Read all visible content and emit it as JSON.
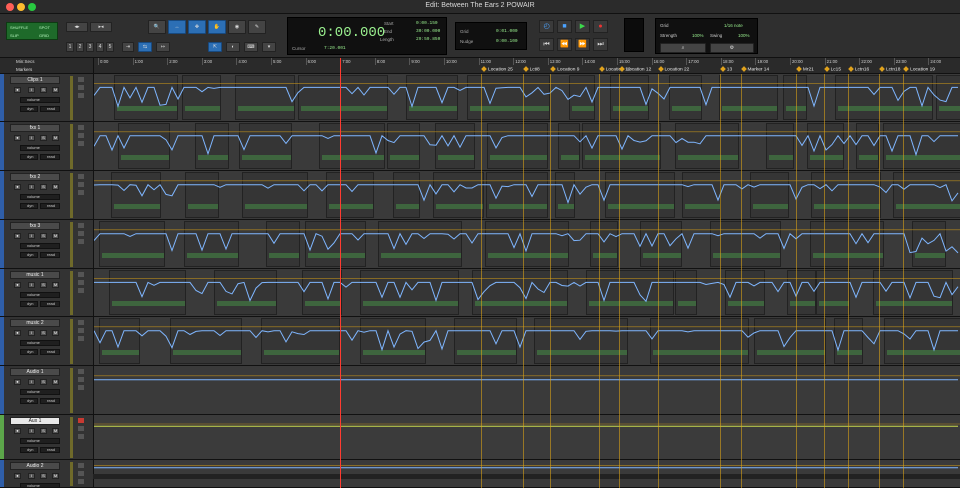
{
  "window": {
    "title": "Edit: Between The Ears 2 POWAIR"
  },
  "toolbar": {
    "modes": [
      "SHUFFLE",
      "SPOT",
      "SLIP",
      "GRID"
    ],
    "zoom_presets": [
      "1",
      "2",
      "3",
      "4",
      "5"
    ],
    "counter_main": "0:00.000",
    "cursor_label": "Cursor",
    "cursor_value": "7:20.001",
    "start_label": "Start",
    "end_label": "End",
    "length_label": "Length",
    "start_value": "0:00.150",
    "end_value": "30:00.000",
    "length_value": "29:59.850",
    "nudge_label": "Nudge",
    "grid_label_small": "Grid",
    "grid_small_value": "0:01.000",
    "nudge_value": "0:00.100",
    "grid_panel": {
      "grid": "Grid",
      "grid_value": "1/16 note",
      "strength": "Strength",
      "strength_value": "100%",
      "swing": "Swing",
      "swing_value": "100%"
    }
  },
  "ruler": {
    "min_secs_label": "Min:Secs",
    "markers_label": "Markers",
    "ticks": [
      "0:00",
      "1:00",
      "2:00",
      "3:00",
      "4:00",
      "5:00",
      "6:00",
      "7:00",
      "8:00",
      "9:00",
      "10:00",
      "11:00",
      "12:00",
      "13:00",
      "14:00",
      "15:00",
      "16:00",
      "17:00",
      "18:00",
      "19:00",
      "20:00",
      "21:00",
      "22:00",
      "23:00",
      "24:00"
    ],
    "markers": [
      {
        "label": "Location 25",
        "t": 11.1
      },
      {
        "label": "Lcti8",
        "t": 12.3
      },
      {
        "label": "Location 9",
        "t": 13.1
      },
      {
        "label": "Location 10",
        "t": 14.5
      },
      {
        "label": "Location 12",
        "t": 15.1
      },
      {
        "label": "Location 22",
        "t": 16.2
      },
      {
        "label": "13",
        "t": 18.0
      },
      {
        "label": "Marker 14",
        "t": 18.6
      },
      {
        "label": "Mr21",
        "t": 20.2
      },
      {
        "label": "Lc15",
        "t": 21.0
      },
      {
        "label": "Lctn16",
        "t": 21.7
      },
      {
        "label": "Lctn18",
        "t": 22.6
      },
      {
        "label": "Location 19",
        "t": 23.3
      }
    ]
  },
  "tracks": [
    {
      "name": "Clips 1",
      "type": "audio",
      "automation": "volume",
      "dyn": "dyn",
      "read": "read"
    },
    {
      "name": "fxs 1",
      "type": "audio",
      "automation": "volume",
      "dyn": "dyn",
      "read": "read"
    },
    {
      "name": "fxs 2",
      "type": "audio",
      "automation": "volume",
      "dyn": "dyn",
      "read": "read"
    },
    {
      "name": "fxs 3",
      "type": "audio",
      "automation": "volume",
      "dyn": "dyn",
      "read": "read"
    },
    {
      "name": "music 1",
      "type": "audio",
      "automation": "volume",
      "dyn": "dyn",
      "read": "read"
    },
    {
      "name": "music 2",
      "type": "audio",
      "automation": "volume",
      "dyn": "dyn",
      "read": "read"
    },
    {
      "name": "Audio 1",
      "type": "audio",
      "automation": "volume",
      "dyn": "dyn",
      "read": "read"
    },
    {
      "name": "Aux 1",
      "type": "aux",
      "automation": "volume",
      "dyn": "dyn",
      "read": "read"
    },
    {
      "name": "Audio 2",
      "type": "audio",
      "automation": "volume",
      "dyn": "dyn",
      "read": "read"
    }
  ],
  "colors": {
    "accent_blue": "#2c6fb5",
    "counter_green": "#9af08f",
    "automation_line": "#7fb6ff",
    "marker": "#e0a21c",
    "playhead": "#ff3b30",
    "record": "#e33333"
  }
}
